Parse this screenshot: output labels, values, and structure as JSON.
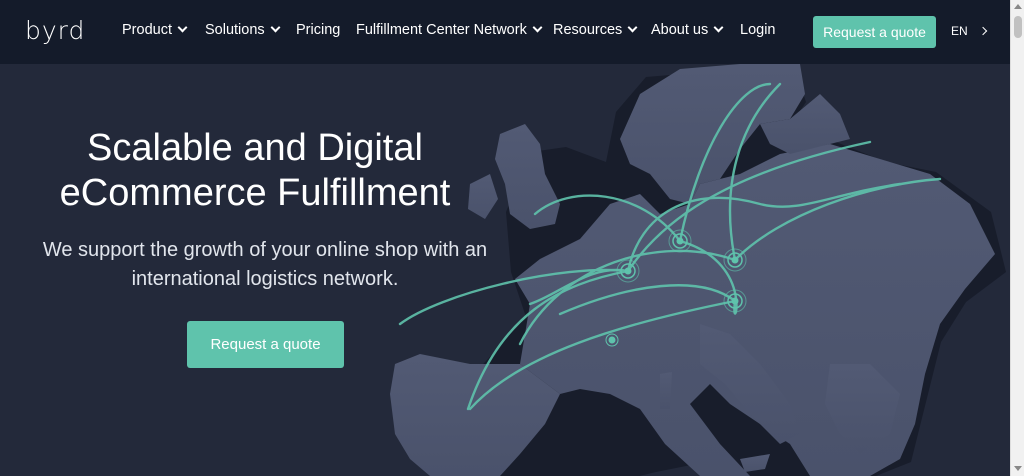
{
  "brand": {
    "logo_text": "byrd"
  },
  "nav": {
    "items": [
      {
        "label": "Product",
        "dropdown": true
      },
      {
        "label": "Solutions",
        "dropdown": true
      },
      {
        "label": "Pricing",
        "dropdown": false
      },
      {
        "label": "Fulfillment Center Network",
        "dropdown": true
      },
      {
        "label": "Resources",
        "dropdown": true
      },
      {
        "label": "About us",
        "dropdown": true
      },
      {
        "label": "Login",
        "dropdown": false
      }
    ],
    "cta_label": "Request a quote",
    "language": "EN"
  },
  "hero": {
    "title_line1": "Scalable and Digital",
    "title_line2": "eCommerce Fulfillment",
    "subtitle_line1": "We support the growth of your online shop with an",
    "subtitle_line2": "international logistics network.",
    "cta_label": "Request a quote"
  },
  "colors": {
    "accent": "#5fc3ac",
    "nav_bg": "#141b2a",
    "hero_bg": "#23293a",
    "map_land": "#4e5670",
    "route": "#5fc3ac"
  },
  "icons": [
    "chevron-down-icon",
    "chevron-right-icon",
    "map-pin-icon"
  ]
}
